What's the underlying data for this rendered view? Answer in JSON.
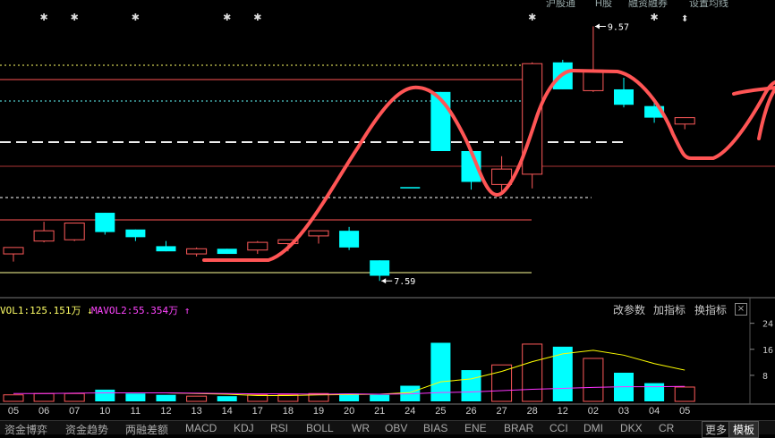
{
  "top_labels": [
    "沪股通",
    "H股",
    "融资融券",
    "设置均线"
  ],
  "markers": {
    "star": "✱",
    "updown": "⬍"
  },
  "price_annotations": {
    "high": "9.57",
    "low": "7.59"
  },
  "volume_header": {
    "vol1": "VOL1:125.151万 ↓",
    "mavol2": "MAVOL2:55.354万 ↑",
    "buttons": [
      "改参数",
      "加指标",
      "换指标"
    ],
    "close": "×"
  },
  "volume_axis_labels": [
    "24",
    "16",
    "8"
  ],
  "dates": [
    "05",
    "06",
    "07",
    "10",
    "11",
    "12",
    "13",
    "14",
    "17",
    "18",
    "19",
    "20",
    "21",
    "24",
    "25",
    "26",
    "27",
    "28",
    "12",
    "02",
    "03",
    "04",
    "05"
  ],
  "tabs": [
    "资金博弈",
    "资金趋势",
    "两融差额",
    "MACD",
    "KDJ",
    "RSI",
    "BOLL",
    "WR",
    "OBV",
    "BIAS",
    "ENE",
    "BRAR",
    "CCI",
    "DMI",
    "DKX",
    "CR"
  ],
  "more_label": "更多",
  "active_tab": "模板",
  "colors": {
    "up": "#ff5a5a",
    "down": "#00ffff",
    "background": "#000000",
    "annotation": "#ff5555",
    "vol_ma1": "#ffff00",
    "vol_ma2": "#ff33ff"
  },
  "chart_data": {
    "type": "candlestick",
    "candles": [
      {
        "o": 7.8,
        "h": 7.85,
        "l": 7.74,
        "c": 7.85,
        "dir": "up"
      },
      {
        "o": 7.9,
        "h": 8.05,
        "l": 7.89,
        "c": 7.98,
        "dir": "up"
      },
      {
        "o": 7.91,
        "h": 8.04,
        "l": 7.9,
        "c": 8.04,
        "dir": "up"
      },
      {
        "o": 8.12,
        "h": 8.12,
        "l": 7.95,
        "c": 7.97,
        "dir": "down"
      },
      {
        "o": 7.99,
        "h": 7.99,
        "l": 7.9,
        "c": 7.93,
        "dir": "down"
      },
      {
        "o": 7.86,
        "h": 7.9,
        "l": 7.82,
        "c": 7.82,
        "dir": "down"
      },
      {
        "o": 7.8,
        "h": 7.85,
        "l": 7.78,
        "c": 7.84,
        "dir": "up"
      },
      {
        "o": 7.84,
        "h": 7.84,
        "l": 7.8,
        "c": 7.8,
        "dir": "down"
      },
      {
        "o": 7.83,
        "h": 7.9,
        "l": 7.8,
        "c": 7.89,
        "dir": "up"
      },
      {
        "o": 7.88,
        "h": 7.91,
        "l": 7.82,
        "c": 7.91,
        "dir": "up"
      },
      {
        "o": 7.94,
        "h": 7.98,
        "l": 7.88,
        "c": 7.98,
        "dir": "up"
      },
      {
        "o": 7.98,
        "h": 8.01,
        "l": 7.83,
        "c": 7.85,
        "dir": "down"
      },
      {
        "o": 7.75,
        "h": 7.75,
        "l": 7.59,
        "c": 7.63,
        "dir": "down"
      },
      {
        "o": 8.32,
        "h": 8.32,
        "l": 8.32,
        "c": 8.32,
        "dir": "down"
      },
      {
        "o": 9.06,
        "h": 9.06,
        "l": 8.6,
        "c": 8.6,
        "dir": "down"
      },
      {
        "o": 8.6,
        "h": 8.62,
        "l": 8.3,
        "c": 8.36,
        "dir": "down"
      },
      {
        "o": 8.34,
        "h": 8.56,
        "l": 8.26,
        "c": 8.46,
        "dir": "up"
      },
      {
        "o": 8.42,
        "h": 9.29,
        "l": 8.31,
        "c": 9.28,
        "dir": "up"
      },
      {
        "o": 9.08,
        "h": 9.31,
        "l": 9.08,
        "c": 9.29,
        "dir": "down"
      },
      {
        "o": 9.07,
        "h": 9.57,
        "l": 9.06,
        "c": 9.23,
        "dir": "up"
      },
      {
        "o": 9.08,
        "h": 9.17,
        "l": 8.94,
        "c": 8.96,
        "dir": "down"
      },
      {
        "o": 8.95,
        "h": 8.99,
        "l": 8.82,
        "c": 8.86,
        "dir": "down"
      },
      {
        "o": 8.81,
        "h": 8.86,
        "l": 8.77,
        "c": 8.86,
        "dir": "up"
      }
    ],
    "volumes": [
      2.0,
      2.4,
      2.4,
      3.6,
      2.4,
      2.0,
      1.6,
      1.6,
      2.0,
      2.0,
      2.4,
      2.4,
      2.0,
      4.8,
      18.0,
      9.6,
      11.2,
      17.6,
      16.8,
      13.2,
      8.8,
      5.6,
      4.4
    ],
    "mavol1": [
      null,
      null,
      null,
      null,
      2.6,
      2.6,
      2.4,
      2.2,
      1.8,
      1.8,
      2.0,
      2.1,
      2.2,
      2.7,
      6.0,
      6.9,
      9.2,
      12.2,
      14.6,
      15.7,
      14.2,
      11.6,
      9.6
    ],
    "mavol2": [
      2.4,
      2.4,
      2.5,
      2.6,
      2.6,
      2.6,
      2.5,
      2.4,
      2.3,
      2.3,
      2.2,
      2.3,
      2.2,
      2.3,
      2.7,
      2.9,
      3.3,
      3.7,
      4.0,
      4.3,
      4.5,
      4.5,
      4.6
    ],
    "ylim_price": [
      7.55,
      9.65
    ],
    "ylim_volume": [
      0,
      25
    ]
  }
}
